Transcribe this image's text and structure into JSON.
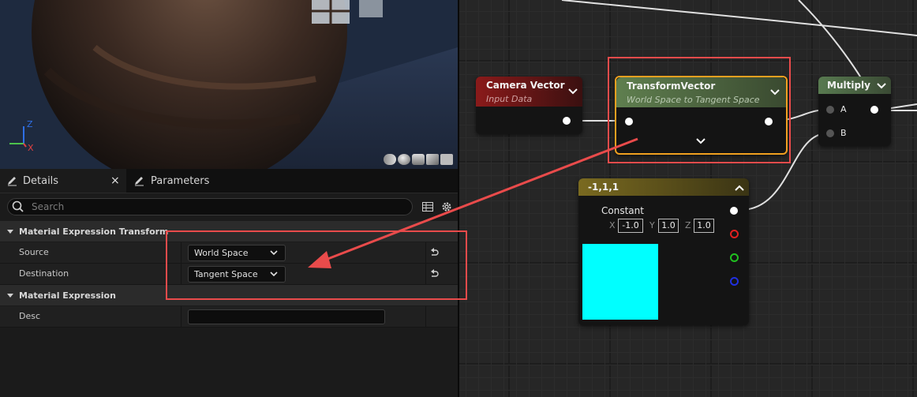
{
  "details_panel": {
    "tabs": [
      {
        "label": "Details",
        "close": "×"
      },
      {
        "label": "Parameters"
      }
    ],
    "search": {
      "placeholder": "Search"
    },
    "sections": [
      {
        "title": "Material Expression Transform",
        "rows": [
          {
            "label": "Source",
            "value": "World Space"
          },
          {
            "label": "Destination",
            "value": "Tangent Space"
          }
        ]
      },
      {
        "title": "Material Expression",
        "rows": [
          {
            "label": "Desc",
            "value": ""
          }
        ]
      }
    ]
  },
  "viewport": {
    "axis_labels": {
      "z": "Z",
      "x": "X"
    }
  },
  "graph": {
    "nodes": {
      "camera_vector": {
        "title": "Camera Vector",
        "subtitle": "Input Data",
        "header_color": "#8a1a1a"
      },
      "transform_vector": {
        "title": "TransformVector",
        "subtitle": "World Space to Tangent Space",
        "header_color": "#5a7a4a",
        "selected": true
      },
      "multiply": {
        "title": "Multiply",
        "pins": [
          "A",
          "B"
        ],
        "header_color": "#4d6e46"
      },
      "constant": {
        "title": "-1,1,1",
        "label": "Constant",
        "components": [
          {
            "axis": "X",
            "value": "-1.0"
          },
          {
            "axis": "Y",
            "value": "1.0"
          },
          {
            "axis": "Z",
            "value": "1.0"
          }
        ],
        "preview_color": "#00ffff",
        "header_color": "#7a6a20"
      }
    }
  },
  "annotation": {
    "highlight_color": "#e94b4b"
  }
}
